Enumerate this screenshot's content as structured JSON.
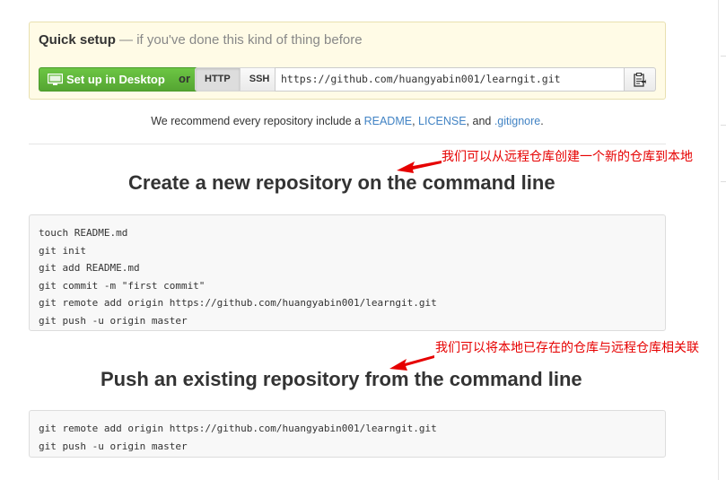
{
  "quick_setup": {
    "title": "Quick setup",
    "subtitle": "— if you've done this kind of thing before",
    "desktop_button": "Set up in Desktop",
    "or_label": "or",
    "protocols": [
      "HTTP",
      "SSH"
    ],
    "selected_protocol": "HTTP",
    "clone_url": "https://github.com/huangyabin001/learngit.git"
  },
  "recommend": {
    "prefix": "We recommend every repository include a ",
    "readme": "README",
    "sep1": ", ",
    "license": "LICENSE",
    "sep2": ", and ",
    "gitignore": ".gitignore",
    "suffix": "."
  },
  "section_new": {
    "title": "Create a new repository on the command line",
    "commands": [
      "touch README.md",
      "git init",
      "git add README.md",
      "git commit -m \"first commit\"",
      "git remote add origin https://github.com/huangyabin001/learngit.git",
      "git push -u origin master"
    ]
  },
  "section_existing": {
    "title": "Push an existing repository from the command line",
    "commands": [
      "git remote add origin https://github.com/huangyabin001/learngit.git",
      "git push -u origin master"
    ]
  },
  "annotations": {
    "note1": "我们可以从远程仓库创建一个新的仓库到本地",
    "note2": "我们可以将本地已存在的仓库与远程仓库相关联",
    "color": "#e60000"
  },
  "colors": {
    "accent_green": "#6cc644",
    "link_blue": "#4183c4",
    "panel_yellow": "#fffbe6"
  }
}
